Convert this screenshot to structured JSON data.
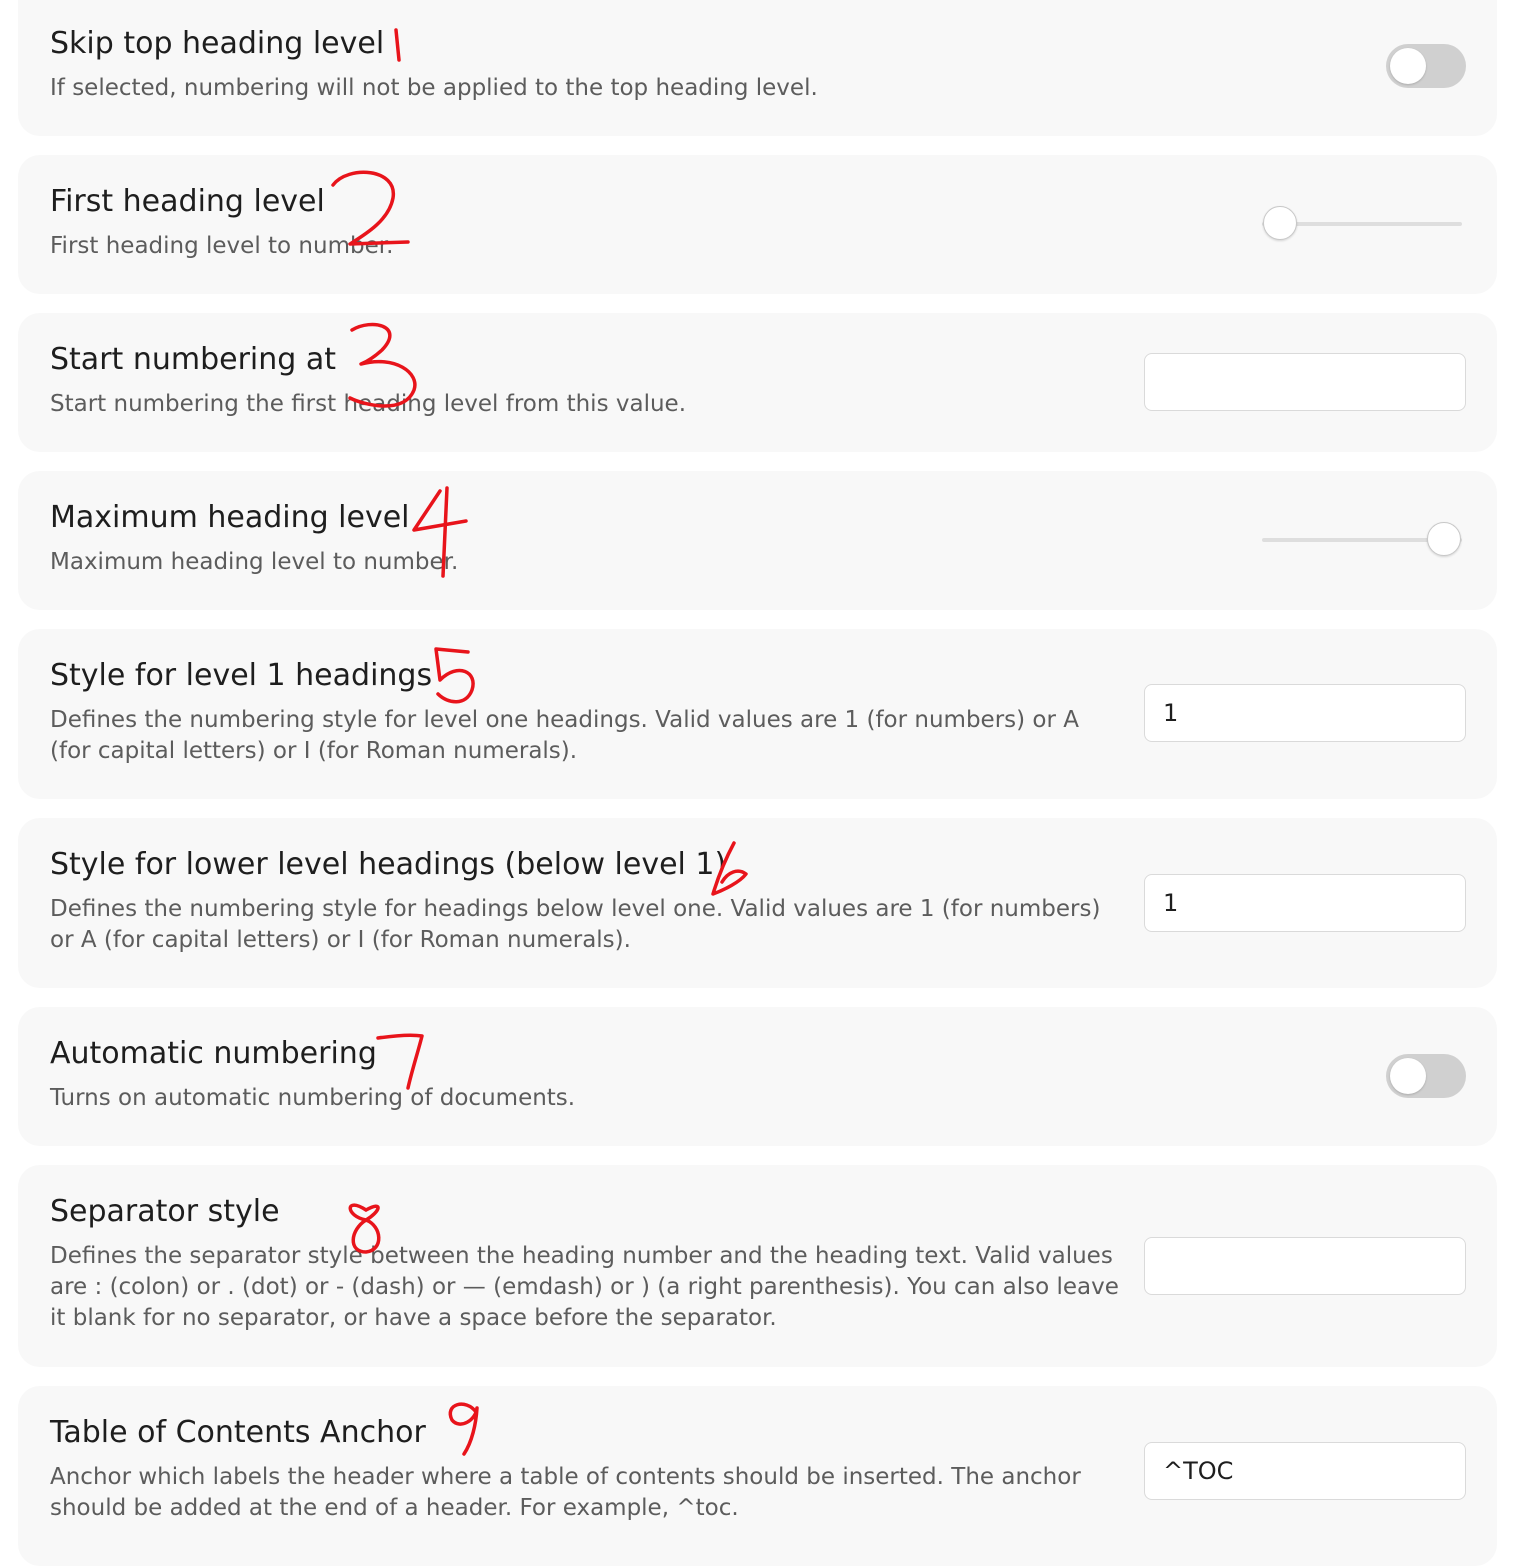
{
  "settings": [
    {
      "title": "Skip top heading level",
      "description": [
        "If selected, numbering will not be applied to the top heading level."
      ],
      "control": "toggle",
      "enabled": false
    },
    {
      "title": "First heading level",
      "description": [
        "First heading level to number."
      ],
      "control": "slider",
      "slider_fraction": 0.09
    },
    {
      "title": "Start numbering at",
      "description": [
        "Start numbering the first heading level from this value."
      ],
      "control": "text",
      "value": ""
    },
    {
      "title": "Maximum heading level",
      "description": [
        "Maximum heading level to number."
      ],
      "control": "slider",
      "slider_fraction": 0.91
    },
    {
      "title": "Style for level 1 headings",
      "description": [
        "Defines the numbering style for level one headings. Valid values are 1 (for numbers) or A",
        "(for capital letters) or I (for Roman numerals)."
      ],
      "control": "text",
      "value": "1"
    },
    {
      "title": "Style for lower level headings (below level 1)",
      "description": [
        "Defines the numbering style for headings below level one. Valid values are 1 (for numbers)",
        "or A (for capital letters) or I (for Roman numerals)."
      ],
      "control": "text",
      "value": "1"
    },
    {
      "title": "Automatic numbering",
      "description": [
        "Turns on automatic numbering of documents."
      ],
      "control": "toggle",
      "enabled": false
    },
    {
      "title": "Separator style",
      "description": [
        "Defines the separator style between the heading number and the heading text. Valid values",
        "are : (colon) or . (dot) or - (dash) or — (emdash) or ) (a right parenthesis). You can also leave",
        "it blank for no separator, or have a space before the separator."
      ],
      "control": "text",
      "value": ""
    },
    {
      "title": "Table of Contents Anchor",
      "description": [
        "Anchor which labels the header where a table of contents should be inserted. The anchor",
        "should be added at the end of a header. For example, ^toc."
      ],
      "control": "text",
      "value": "^TOC"
    }
  ],
  "annotation_numbers": [
    "1",
    "2",
    "3",
    "4",
    "5",
    "6",
    "7",
    "8",
    "9"
  ],
  "colors": {
    "card_background": "#f8f8f8",
    "toggle_off": "#d0d0d0",
    "annotation_ink": "#e8141b"
  }
}
